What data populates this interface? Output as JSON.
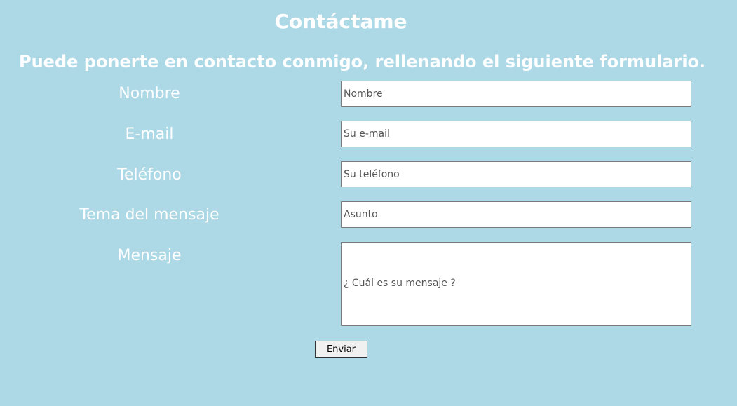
{
  "page": {
    "title": "Contáctame",
    "subtitle": "Puede ponerte en contacto conmigo, rellenando el siguiente formulario."
  },
  "form": {
    "name": {
      "label": "Nombre",
      "placeholder": "Nombre",
      "value": ""
    },
    "email": {
      "label": "E-mail",
      "placeholder": "Su e-mail",
      "value": ""
    },
    "phone": {
      "label": "Teléfono",
      "placeholder": "Su teléfono",
      "value": ""
    },
    "subject": {
      "label": "Tema del mensaje",
      "placeholder": "Asunto",
      "value": ""
    },
    "message": {
      "label": "Mensaje",
      "placeholder": "¿ Cuál es su mensaje ?",
      "value": ""
    },
    "submit_label": "Enviar"
  },
  "colors": {
    "background": "#add8e6",
    "text": "#ffffff"
  }
}
